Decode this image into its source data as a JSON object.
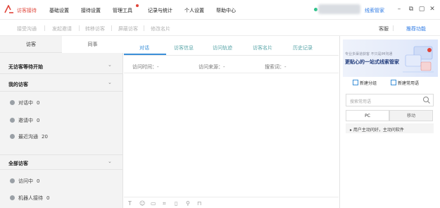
{
  "nav": {
    "items": [
      {
        "label": "访客接待",
        "active": true
      },
      {
        "label": "基础设置",
        "active": false
      },
      {
        "label": "接待设置",
        "active": false
      },
      {
        "label": "管理工具",
        "active": false
      },
      {
        "label": "记录与统计",
        "active": false
      },
      {
        "label": "个人设置",
        "active": false
      },
      {
        "label": "帮助中心",
        "active": false
      }
    ],
    "right_link": "线索管家",
    "window_controls": [
      "minimize-icon",
      "restore-icon",
      "maximize-icon",
      "close-icon"
    ]
  },
  "toolbar": {
    "items": [
      "接受沟通",
      "发起邀请",
      "转移访客",
      "屏蔽访客",
      "修改名片"
    ],
    "right_items": [
      "客服",
      "推荐功能"
    ]
  },
  "left": {
    "tabs": [
      "访客",
      "同事"
    ],
    "waiting_title": "无访客等待开始",
    "my_visitors_title": "我的访客",
    "my_rows": [
      {
        "label": "对话中",
        "count": "0"
      },
      {
        "label": "邀请中",
        "count": "0"
      },
      {
        "label": "最近沟通",
        "count": "20"
      }
    ],
    "all_visitors_title": "全部访客",
    "all_rows": [
      {
        "label": "访问中",
        "count": "0"
      },
      {
        "label": "机器人接待",
        "count": "0"
      }
    ]
  },
  "center": {
    "tabs": [
      "对话",
      "访客信息",
      "访问轨迹",
      "访客名片",
      "历史记录"
    ],
    "filters": [
      "访问时间：-",
      "访问来源：-",
      "搜索词：-"
    ]
  },
  "right": {
    "banner_small": "专业多渠道获客 不只是IM沟通",
    "banner_big": "更贴心的一站式线索管家",
    "button_group": "新建分组",
    "button_phrase": "新建常用语",
    "search_placeholder": "搜索常用语",
    "tabs": [
      "PC",
      "移动"
    ],
    "list_item": "用户主动问好，主动问软件"
  },
  "colors": {
    "accent_red": "#e0453a",
    "accent_blue": "#3a8fd8",
    "status_green": "#2fc28b"
  }
}
